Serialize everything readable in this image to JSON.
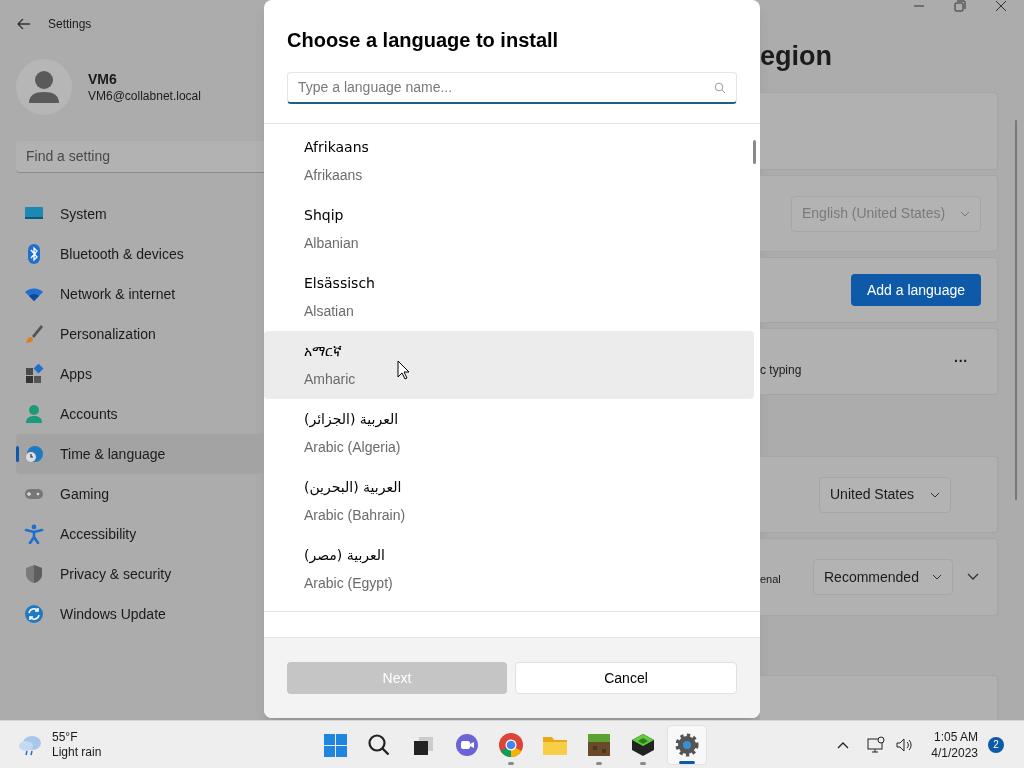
{
  "window": {
    "title": "Settings"
  },
  "account": {
    "name": "VM6",
    "email": "VM6@collabnet.local"
  },
  "search": {
    "placeholder": "Find a setting"
  },
  "nav": [
    {
      "label": "System",
      "kind": "system",
      "selected": false
    },
    {
      "label": "Bluetooth & devices",
      "kind": "bluetooth",
      "selected": false
    },
    {
      "label": "Network & internet",
      "kind": "network",
      "selected": false
    },
    {
      "label": "Personalization",
      "kind": "brush",
      "selected": false
    },
    {
      "label": "Apps",
      "kind": "apps",
      "selected": false
    },
    {
      "label": "Accounts",
      "kind": "accounts",
      "selected": false
    },
    {
      "label": "Time & language",
      "kind": "time",
      "selected": true
    },
    {
      "label": "Gaming",
      "kind": "gaming",
      "selected": false
    },
    {
      "label": "Accessibility",
      "kind": "accessibility",
      "selected": false
    },
    {
      "label": "Privacy & security",
      "kind": "privacy",
      "selected": false
    },
    {
      "label": "Windows Update",
      "kind": "update",
      "selected": false
    }
  ],
  "page": {
    "title": "egion",
    "cards": [
      {
        "kind": "empty"
      },
      {
        "kind": "dropdown",
        "value": "English (United States)",
        "disabled": true
      },
      {
        "kind": "button",
        "label": "Add a language"
      },
      {
        "kind": "more",
        "text": "c typing",
        "more": "···"
      },
      {
        "kind": "dropdown",
        "value": "United States",
        "disabled": false
      },
      {
        "kind": "dropdown_expand",
        "text": "enal",
        "value": "Recommended",
        "disabled": false
      },
      {
        "kind": "empty"
      }
    ]
  },
  "dialog": {
    "title": "Choose a language to install",
    "search": {
      "placeholder": "Type a language name..."
    },
    "languages": [
      {
        "native": "Afrikaans",
        "english": "Afrikaans",
        "highlighted": false
      },
      {
        "native": "Shqip",
        "english": "Albanian",
        "highlighted": false
      },
      {
        "native": "Elsässisch",
        "english": "Alsatian",
        "highlighted": false
      },
      {
        "native": "አማርኛ",
        "english": "Amharic",
        "highlighted": true
      },
      {
        "native": "العربية (الجزائر)",
        "english": "Arabic (Algeria)",
        "highlighted": false
      },
      {
        "native": "العربية (البحرين)",
        "english": "Arabic (Bahrain)",
        "highlighted": false
      },
      {
        "native": "العربية (مصر)",
        "english": "Arabic (Egypt)",
        "highlighted": false
      }
    ],
    "buttons": [
      {
        "label": "Next",
        "kind": "primary",
        "disabled": true
      },
      {
        "label": "Cancel",
        "kind": "secondary",
        "disabled": false
      }
    ]
  },
  "taskbar": {
    "weather": {
      "temp": "55°F",
      "condition": "Light rain"
    },
    "apps": [
      {
        "kind": "start",
        "running": false,
        "active": false
      },
      {
        "kind": "search",
        "running": false,
        "active": false
      },
      {
        "kind": "taskview",
        "running": false,
        "active": false
      },
      {
        "kind": "chat",
        "running": false,
        "active": false
      },
      {
        "kind": "browser",
        "running": true,
        "active": false
      },
      {
        "kind": "folder",
        "running": false,
        "active": false
      },
      {
        "kind": "grassblock",
        "running": true,
        "active": false
      },
      {
        "kind": "launcher",
        "running": true,
        "active": false
      },
      {
        "kind": "settings",
        "running": true,
        "active": true
      }
    ],
    "clock": {
      "time": "1:05 AM",
      "date": "4/1/2023"
    },
    "notifications": "2"
  }
}
